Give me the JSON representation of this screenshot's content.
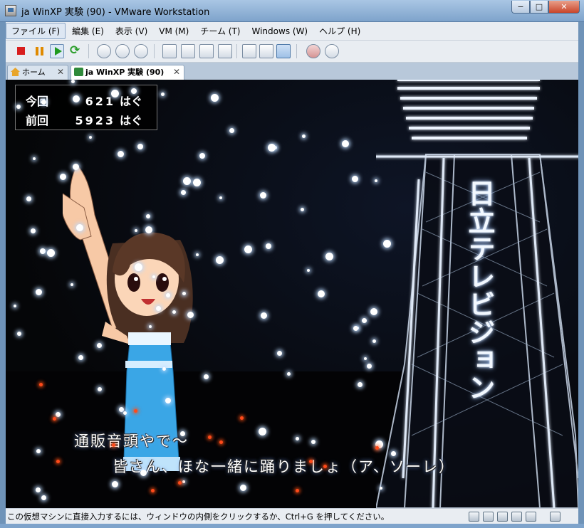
{
  "window": {
    "title": "ja WinXP 実験 (90) - VMware Workstation",
    "min_label": "−",
    "max_label": "□",
    "close_label": "✕"
  },
  "menu": [
    "ファイル (F)",
    "編集 (E)",
    "表示 (V)",
    "VM (M)",
    "チーム (T)",
    "Windows (W)",
    "ヘルプ (H)"
  ],
  "tabs": {
    "home": "ホーム",
    "vm": "ja WinXP 実験 (90)",
    "close_glyph": "✕"
  },
  "game": {
    "score": [
      {
        "label": "今回",
        "value": "621",
        "unit": "はぐ"
      },
      {
        "label": "前回",
        "value": "5923",
        "unit": "はぐ"
      }
    ],
    "sign": "日立テレビジョン",
    "lyrics": [
      "通販音頭やで～",
      "皆さん、ほな一緒に踊りましょ（ア、ソーレ）"
    ]
  },
  "status": {
    "text": "この仮想マシンに直接入力するには、ウィンドウの内側をクリックするか、Ctrl+G を押してください。"
  },
  "icons": {
    "toolbar": [
      "stop-icon",
      "pause-icon",
      "play-icon",
      "reset-icon",
      "snapshot-icon",
      "revert-snapshot-icon",
      "snapshot-manager-icon",
      "sidebar-icon",
      "fullscreen-icon",
      "quick-switch-icon",
      "console-view-icon",
      "unity-icon",
      "summary-icon",
      "appliance-view-icon",
      "record-icon",
      "replay-icon"
    ],
    "status": [
      "hdd-icon",
      "network-icon",
      "usb-icon",
      "sound-icon",
      "folder-icon",
      "message-icon"
    ]
  },
  "colors": {
    "titlebar": "#7ea3cb",
    "menubar": "#e9edf2",
    "screen_bg": "#050608",
    "sign_glow": "#9fc6ff",
    "snow": "#ffffff",
    "ember": "#ff4a1a"
  }
}
